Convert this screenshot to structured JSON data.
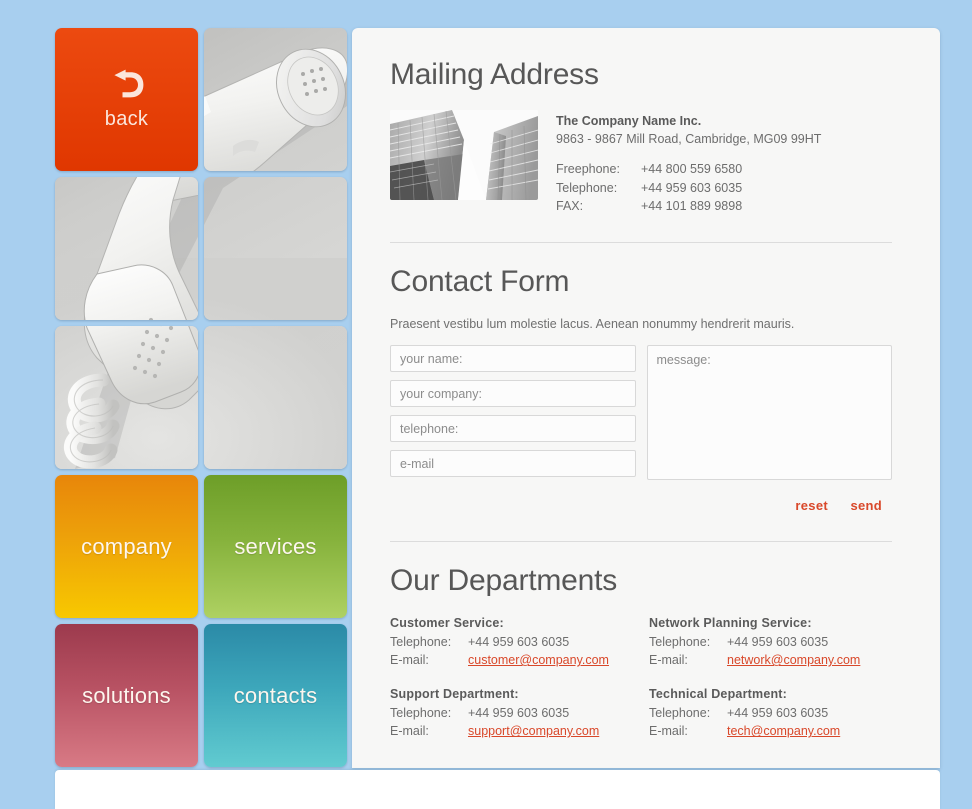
{
  "theme": {
    "page_background": "#a8cfef",
    "panel_background": "#f7f7f6",
    "accent_red": "#d9482a",
    "heading_gray": "#575757",
    "body_gray": "#6d6d6d"
  },
  "nav": {
    "back": {
      "label": "back",
      "icon": "back-arrow-icon",
      "color": "#e8400c"
    },
    "tiles": [
      {
        "label": "company",
        "color_start": "#e8860a",
        "color_end": "#f8c800"
      },
      {
        "label": "services",
        "color_start": "#6d9e28",
        "color_end": "#aed162"
      },
      {
        "label": "solutions",
        "color_start": "#9c3a4d",
        "color_end": "#d87a85"
      },
      {
        "label": "contacts",
        "color_start": "#2b8aa7",
        "color_end": "#61cbd0"
      }
    ],
    "photo_alt": "telephone-handset-photo"
  },
  "mailing": {
    "title": "Mailing Address",
    "photo_alt": "skyscrapers-photo",
    "company_name": "The Company Name Inc.",
    "street": "9863 - 9867 Mill Road, Cambridge, MG09 99HT",
    "phones": [
      {
        "label": "Freephone:",
        "value": "+44 800 559 6580"
      },
      {
        "label": "Telephone:",
        "value": "+44 959 603 6035"
      },
      {
        "label": "FAX:",
        "value": "+44 101 889 9898"
      }
    ]
  },
  "form": {
    "title": "Contact Form",
    "intro": "Praesent vestibu lum molestie lacus. Aenean nonummy hendrerit mauris.",
    "fields": [
      {
        "name": "your-name-input",
        "placeholder": "your name:",
        "value": ""
      },
      {
        "name": "your-company-input",
        "placeholder": "your company:",
        "value": ""
      },
      {
        "name": "telephone-input",
        "placeholder": "telephone:",
        "value": ""
      },
      {
        "name": "email-input",
        "placeholder": "e-mail",
        "value": ""
      }
    ],
    "message": {
      "placeholder": "message:",
      "value": ""
    },
    "reset_label": "reset",
    "send_label": "send"
  },
  "departments": {
    "title": "Our Departments",
    "phone_label": "Telephone:",
    "email_label": "E-mail:",
    "items": [
      {
        "name": "Customer Service:",
        "phone": "+44 959 603 6035",
        "email": "customer@company.com"
      },
      {
        "name": "Network Planning Service:",
        "phone": "+44 959 603 6035",
        "email": "network@company.com"
      },
      {
        "name": "Support Department:",
        "phone": "+44 959 603 6035",
        "email": "support@company.com"
      },
      {
        "name": "Technical Department:",
        "phone": "+44 959 603 6035",
        "email": "tech@company.com"
      }
    ]
  }
}
